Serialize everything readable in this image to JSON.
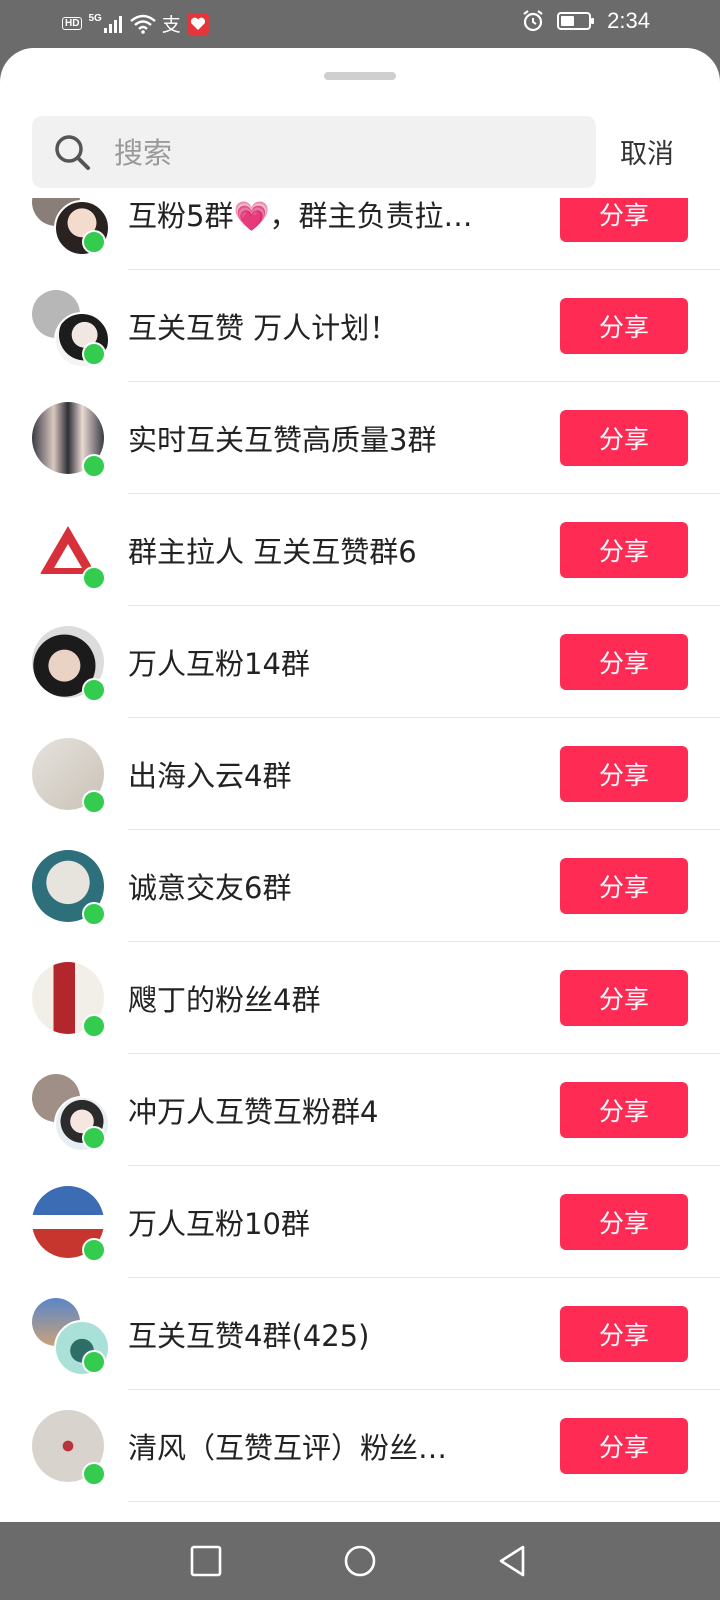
{
  "status_bar": {
    "hd": "HD",
    "network": "5G",
    "pay_glyph": "支",
    "time": "2:34"
  },
  "search": {
    "placeholder": "搜索",
    "value": "",
    "cancel_label": "取消"
  },
  "groups": [
    {
      "name": "互粉5群💗，群主负责拉…",
      "button": "分享"
    },
    {
      "name": "互关互赞 万人计划！",
      "button": "分享"
    },
    {
      "name": "实时互关互赞高质量3群",
      "button": "分享"
    },
    {
      "name": "群主拉人 互关互赞群6",
      "button": "分享"
    },
    {
      "name": "万人互粉14群",
      "button": "分享"
    },
    {
      "name": "出海入云4群",
      "button": "分享"
    },
    {
      "name": "诚意交友6群",
      "button": "分享"
    },
    {
      "name": "飕丁的粉丝4群",
      "button": "分享"
    },
    {
      "name": "冲万人互赞互粉群4",
      "button": "分享"
    },
    {
      "name": "万人互粉10群",
      "button": "分享"
    },
    {
      "name": "互关互赞4群(425)",
      "button": "分享"
    },
    {
      "name": "清风（互赞互评）粉丝…",
      "button": "分享"
    }
  ],
  "colors": {
    "share_button": "#fe2c55",
    "online_dot": "#33cc4e",
    "system_bar": "#6b6b6b"
  }
}
